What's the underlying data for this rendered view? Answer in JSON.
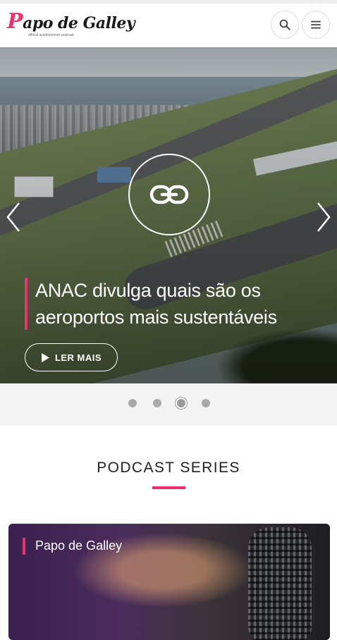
{
  "brand": {
    "logo_text_p": "P",
    "logo_text_rest": "apo de Galley",
    "logo_tagline": "official aviation/news podcast",
    "accent_color": "#e8336d"
  },
  "header": {
    "search_icon": "search-icon",
    "menu_icon": "hamburger-menu-icon"
  },
  "hero": {
    "link_icon": "link-icon",
    "headline_line1": "ANAC divulga quais são os",
    "headline_line2": "aeroportos mais sustentáveis",
    "read_more_label": "LER MAIS",
    "prev_icon": "chevron-left-icon",
    "next_icon": "chevron-right-icon"
  },
  "carousel": {
    "total": 4,
    "active_index": 3
  },
  "section": {
    "title": "PODCAST SERIES"
  },
  "podcast_card": {
    "title": "Papo de Galley"
  }
}
